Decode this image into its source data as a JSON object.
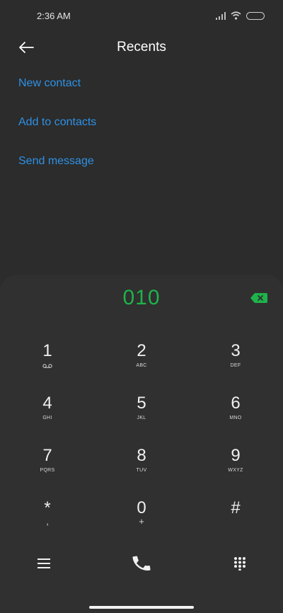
{
  "status": {
    "time": "2:36 AM"
  },
  "header": {
    "title": "Recents"
  },
  "actions": [
    {
      "label": "New contact"
    },
    {
      "label": "Add to contacts"
    },
    {
      "label": "Send message"
    }
  ],
  "dialer": {
    "number": "010",
    "keys": [
      {
        "digit": "1",
        "letters": "voicemail-icon"
      },
      {
        "digit": "2",
        "letters": "ABC"
      },
      {
        "digit": "3",
        "letters": "DEF"
      },
      {
        "digit": "4",
        "letters": "GHI"
      },
      {
        "digit": "5",
        "letters": "JKL"
      },
      {
        "digit": "6",
        "letters": "MNO"
      },
      {
        "digit": "7",
        "letters": "PQRS"
      },
      {
        "digit": "8",
        "letters": "TUV"
      },
      {
        "digit": "9",
        "letters": "WXYZ"
      },
      {
        "digit": "*",
        "letters": ","
      },
      {
        "digit": "0",
        "letters": "+"
      },
      {
        "digit": "#",
        "letters": ""
      }
    ]
  },
  "colors": {
    "background": "#2b2c2b",
    "accent_link": "#2f90e6",
    "number_green": "#1fb24a"
  }
}
